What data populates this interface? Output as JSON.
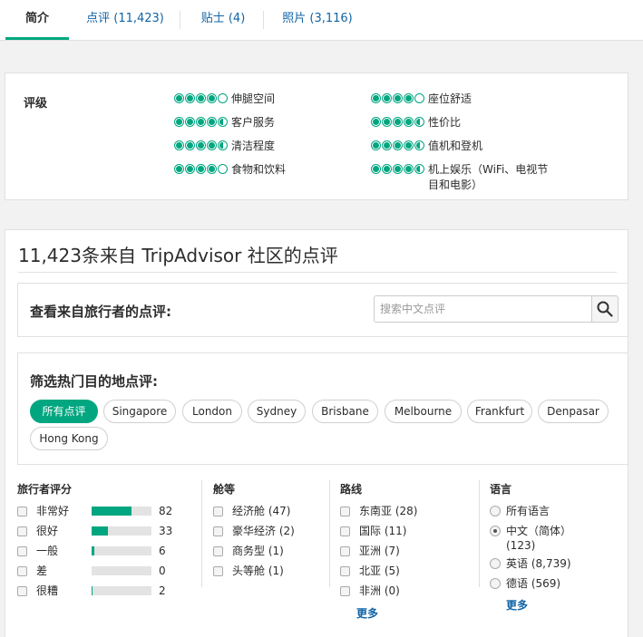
{
  "tabs": [
    {
      "label": "简介"
    },
    {
      "label": "点评 (11,423)"
    },
    {
      "label": "贴士 (4)"
    },
    {
      "label": "照片 (3,116)"
    }
  ],
  "ratings": {
    "title": "评级",
    "items": [
      {
        "label": "伸腿空间",
        "score": 4
      },
      {
        "label": "客户服务",
        "score": 4.5
      },
      {
        "label": "清洁程度",
        "score": 4.5
      },
      {
        "label": "食物和饮料",
        "score": 4
      },
      {
        "label": "座位舒适",
        "score": 4
      },
      {
        "label": "性价比",
        "score": 4.5
      },
      {
        "label": "值机和登机",
        "score": 4.5
      },
      {
        "label": "机上娱乐（WiFi、电视节目和电影）",
        "score": 4.5
      }
    ]
  },
  "reviews": {
    "title": "11,423条来自 TripAdvisor 社区的点评",
    "search_title": "查看来自旅行者的点评:",
    "search_placeholder": "搜索中文点评",
    "filter_title": "筛选热门目的地点评:",
    "chips": [
      "所有点评",
      "Singapore",
      "London",
      "Sydney",
      "Brisbane",
      "Melbourne",
      "Frankfurt",
      "Denpasar",
      "Hong Kong"
    ]
  },
  "filters": {
    "traveler_rating": {
      "title": "旅行者评分",
      "rows": [
        {
          "label": "非常好",
          "count": "82",
          "fraction": 0.67
        },
        {
          "label": "很好",
          "count": "33",
          "fraction": 0.27
        },
        {
          "label": "一般",
          "count": "6",
          "fraction": 0.05
        },
        {
          "label": "差",
          "count": "0",
          "fraction": 0
        },
        {
          "label": "很糟",
          "count": "2",
          "fraction": 0.02
        }
      ]
    },
    "cabin": {
      "title": "舱等",
      "rows": [
        "经济舱 (47)",
        "豪华经济 (2)",
        "商务型 (1)",
        "头等舱 (1)"
      ]
    },
    "route": {
      "title": "路线",
      "rows": [
        "东南亚 (28)",
        "国际 (11)",
        "亚洲 (7)",
        "北亚 (5)",
        "非洲 (0)"
      ],
      "more": "更多"
    },
    "language": {
      "title": "语言",
      "rows": [
        {
          "label": "所有语言",
          "checked": false
        },
        {
          "label": "中文（简体）(123)",
          "checked": true
        },
        {
          "label": "英语 (8,739)",
          "checked": false
        },
        {
          "label": "德语 (569)",
          "checked": false
        }
      ],
      "more": "更多"
    }
  }
}
